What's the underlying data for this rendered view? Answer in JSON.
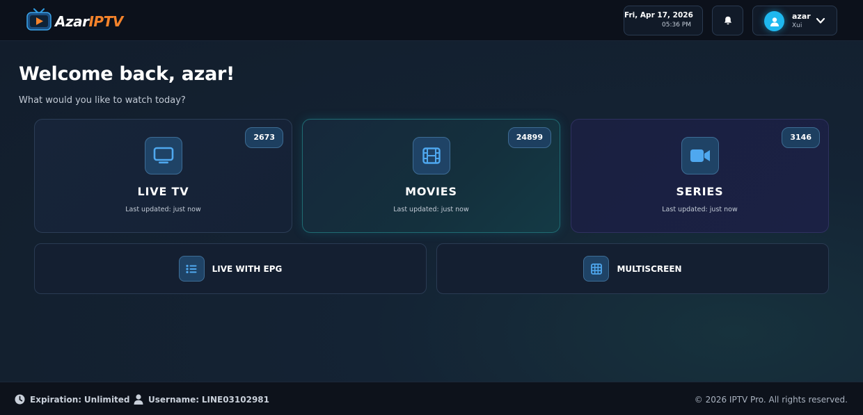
{
  "header": {
    "logo": {
      "text_main": "Azar",
      "text_accent": "IPTV"
    },
    "date": "Fri, Apr 17, 2026",
    "time": "05:36 PM",
    "user": {
      "name": "azar",
      "subtitle": "Xui"
    }
  },
  "welcome": {
    "title": "Welcome back, azar!",
    "subtitle": "What would you like to watch today?"
  },
  "cards": [
    {
      "title": "LIVE TV",
      "count": "2673",
      "updated": "Last updated: just now",
      "icon": "monitor-icon"
    },
    {
      "title": "MOVIES",
      "count": "24899",
      "updated": "Last updated: just now",
      "icon": "film-icon"
    },
    {
      "title": "SERIES",
      "count": "3146",
      "updated": "Last updated: just now",
      "icon": "video-camera-icon"
    }
  ],
  "wide_buttons": [
    {
      "label": "LIVE WITH EPG",
      "icon": "list-icon"
    },
    {
      "label": "MULTISCREEN",
      "icon": "grid-icon"
    }
  ],
  "footer": {
    "expiration_label": "Expiration:",
    "expiration_value": "Unlimited",
    "username_label": "Username:",
    "username_value": "LINE03102981",
    "copyright": "© 2026 IPTV Pro. All rights reserved."
  },
  "colors": {
    "accent_blue": "#4fa8ef",
    "logo_orange": "#f5832b",
    "avatar_cyan": "#1fb8ef",
    "movies_border": "#1f6b73"
  }
}
